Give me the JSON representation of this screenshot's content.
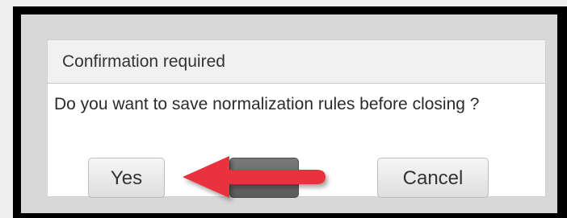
{
  "dialog": {
    "title": "Confirmation required",
    "message": "Do you want to save normalization rules before closing ?",
    "buttons": {
      "yes": "Yes",
      "no": "",
      "cancel": "Cancel"
    }
  },
  "colors": {
    "frame": "#000000",
    "backdrop": "#d8d8d8",
    "header_bg": "#f1f1f1",
    "arrow": "#e8303c"
  },
  "icons": {
    "annotation_arrow": "red-arrow-icon"
  }
}
